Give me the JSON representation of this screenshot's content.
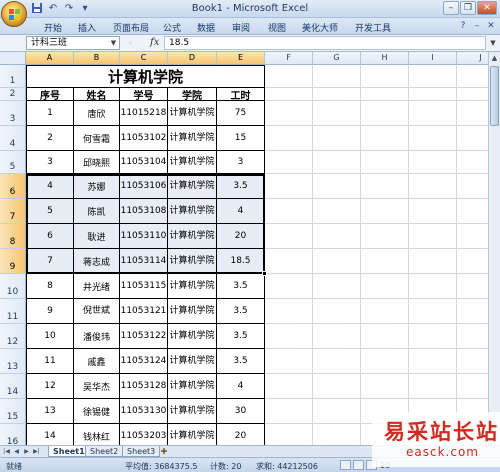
{
  "window": {
    "title": "Book1 - Microsoft Excel",
    "controls": [
      "minimize",
      "restore",
      "close"
    ]
  },
  "quick_access": [
    "save-icon",
    "undo-icon",
    "redo-icon",
    "customize-icon"
  ],
  "ribbon": {
    "tabs": [
      "开始",
      "插入",
      "页面布局",
      "公式",
      "数据",
      "审阅",
      "视图",
      "美化大师",
      "开发工具"
    ],
    "help_icons": [
      "help-icon",
      "minimize-ribbon-icon",
      "close-workbook-icon"
    ]
  },
  "formula_bar": {
    "name_box": "计科三班",
    "fx": "fx",
    "value": "18.5"
  },
  "columns": [
    "A",
    "B",
    "C",
    "D",
    "E",
    "F",
    "G",
    "H",
    "I",
    "J"
  ],
  "rows": [
    "1",
    "2",
    "3",
    "4",
    "5",
    "6",
    "7",
    "8",
    "9",
    "10",
    "11",
    "12",
    "13",
    "14",
    "15",
    "16"
  ],
  "selected_range": "A6:E9",
  "table": {
    "title": "计算机学院",
    "headers": [
      "序号",
      "姓名",
      "学号",
      "学院",
      "工时"
    ],
    "rows": [
      [
        "1",
        "唐欣",
        "11015218",
        "计算机学院",
        "75"
      ],
      [
        "2",
        "何雪霜",
        "11053102",
        "计算机学院",
        "15"
      ],
      [
        "3",
        "邱晓熙",
        "11053104",
        "计算机学院",
        "3"
      ],
      [
        "4",
        "苏娜",
        "11053106",
        "计算机学院",
        "3.5"
      ],
      [
        "5",
        "陈凯",
        "11053108",
        "计算机学院",
        "4"
      ],
      [
        "6",
        "耿进",
        "11053110",
        "计算机学院",
        "20"
      ],
      [
        "7",
        "蒋志成",
        "11053114",
        "计算机学院",
        "18.5"
      ],
      [
        "8",
        "井光绪",
        "11053115",
        "计算机学院",
        "3.5"
      ],
      [
        "9",
        "倪世斌",
        "11053121",
        "计算机学院",
        "3.5"
      ],
      [
        "10",
        "潘俊玮",
        "11053122",
        "计算机学院",
        "3.5"
      ],
      [
        "11",
        "戚鑫",
        "11053124",
        "计算机学院",
        "3.5"
      ],
      [
        "12",
        "吴华杰",
        "11053128",
        "计算机学院",
        "4"
      ],
      [
        "13",
        "徐锡健",
        "11053130",
        "计算机学院",
        "30"
      ],
      [
        "14",
        "钱林红",
        "11053203",
        "计算机学院",
        "20"
      ]
    ]
  },
  "sheet_tabs": [
    "Sheet1",
    "Sheet2",
    "Sheet3"
  ],
  "status": {
    "mode": "就绪",
    "average": "平均值: 3684375.5",
    "count": "计数: 20",
    "sum": "求和: 44212506",
    "zoom": "10"
  },
  "watermark": {
    "main": "易采站长站",
    "sub": "easck.com"
  }
}
